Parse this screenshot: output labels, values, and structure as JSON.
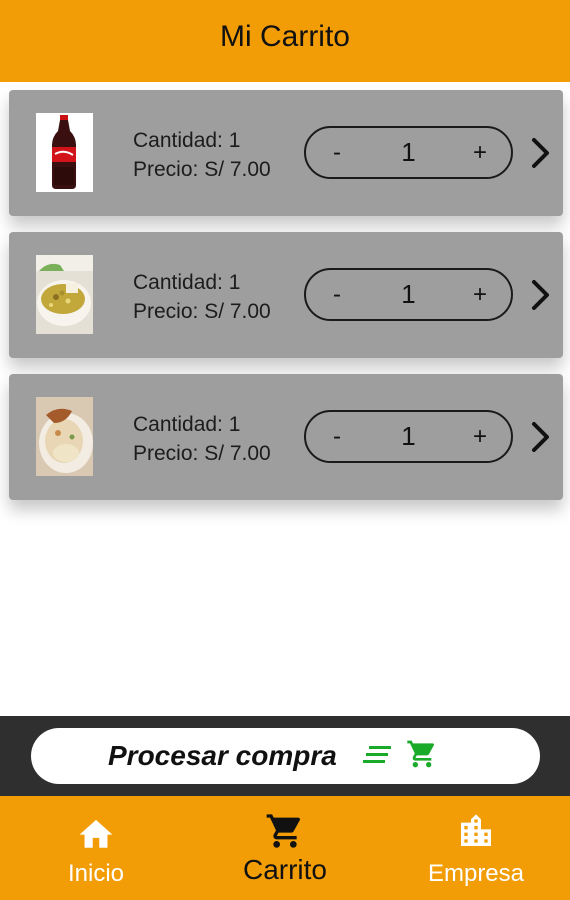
{
  "header": {
    "title": "Mi Carrito"
  },
  "cart": {
    "items": [
      {
        "image": "coca-cola-bottle-photo",
        "quantity_text": "Cantidad: 1",
        "price_text": "Precio: S/ 7.00",
        "minus": "-",
        "qty": "1",
        "plus": "+"
      },
      {
        "image": "rice-dish-photo",
        "quantity_text": "Cantidad: 1",
        "price_text": "Precio: S/ 7.00",
        "minus": "-",
        "qty": "1",
        "plus": "+"
      },
      {
        "image": "food-plate-photo",
        "quantity_text": "Cantidad: 1",
        "price_text": "Precio: S/ 7.00",
        "minus": "-",
        "qty": "1",
        "plus": "+"
      }
    ]
  },
  "checkout": {
    "label": "Procesar compra",
    "icons": [
      "list-lines-icon",
      "cart-icon"
    ],
    "accent": "#1AAA2A"
  },
  "nav": {
    "items": [
      {
        "label": "Inicio",
        "icon": "home-icon"
      },
      {
        "label": "Carrito",
        "icon": "cart-icon",
        "active": true
      },
      {
        "label": "Empresa",
        "icon": "building-icon"
      }
    ]
  },
  "colors": {
    "brand": "#F29D06",
    "card": "#9E9E9E",
    "footer": "#2F2F2F"
  }
}
